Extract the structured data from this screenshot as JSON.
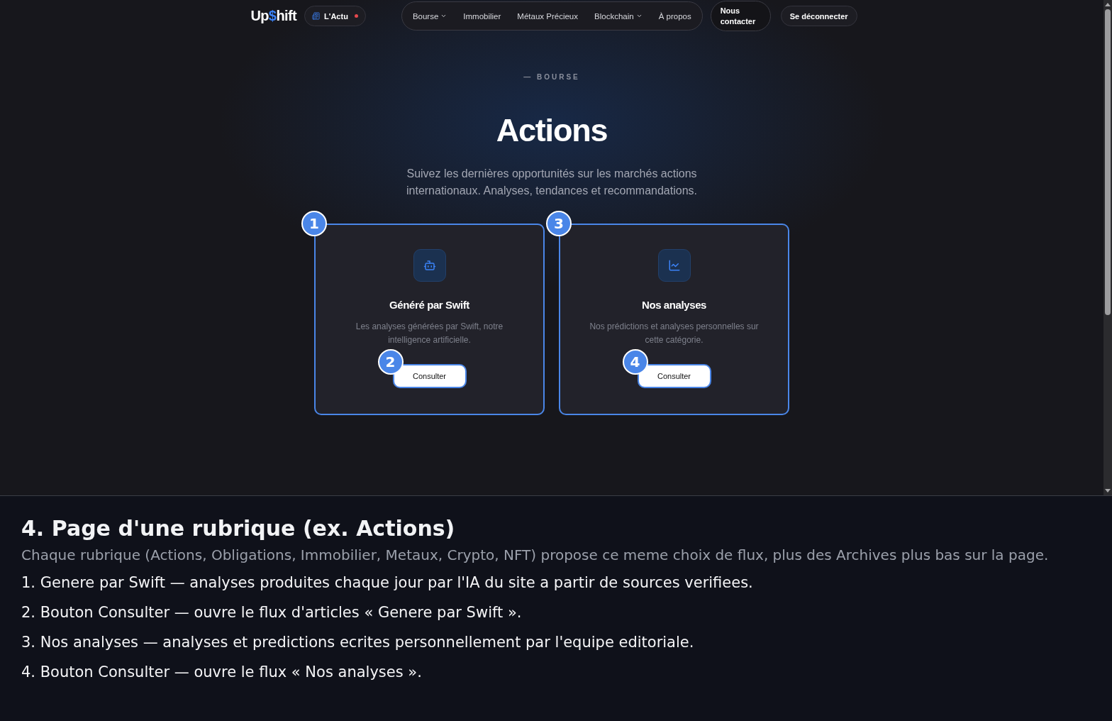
{
  "page": {
    "nav": {
      "logo": {
        "start": "Up",
        "accent": "$",
        "end": "hift"
      },
      "news_button": {
        "label": "L'Actu",
        "unread_dot": true
      },
      "menu": [
        {
          "label": "Bourse",
          "dropdown": true
        },
        {
          "label": "Immobilier",
          "dropdown": false
        },
        {
          "label": "Métaux Précieux",
          "dropdown": false
        },
        {
          "label": "Blockchain",
          "dropdown": true
        },
        {
          "label": "À propos",
          "dropdown": false
        }
      ],
      "contact_button": "Nous contacter",
      "logout_button": "Se déconnecter"
    },
    "hero": {
      "eyebrow": "— BOURSE",
      "title": "Actions",
      "subtitle": "Suivez les dernières opportunités sur les marchés actions internationaux. Analyses, tendances et recommandations."
    },
    "cards": [
      {
        "kind": "generated",
        "marker": "1",
        "title": "Généré par Swift",
        "description": "Les analyses générées par Swift, notre intelligence artificielle.",
        "button": {
          "label": "Consulter",
          "marker": "2"
        }
      },
      {
        "kind": "editorial",
        "marker": "3",
        "title": "Nos analyses",
        "description": "Nos prédictions et analyses personnelles sur cette catégorie.",
        "button": {
          "label": "Consulter",
          "marker": "4"
        }
      }
    ]
  },
  "explanation": {
    "heading": "4. Page d'une rubrique (ex. Actions)",
    "intro": "Chaque rubrique (Actions, Obligations, Immobilier, Metaux, Crypto, NFT) propose ce meme choix de flux, plus des Archives plus bas sur la page.",
    "items": [
      "1. Genere par Swift — analyses produites chaque jour par l'IA du site a partir de sources verifiees.",
      "2. Bouton Consulter — ouvre le flux d'articles « Genere par Swift ».",
      "3. Nos analyses — analyses et predictions ecrites personnellement par l'equipe editoriale.",
      "4. Bouton Consulter — ouvre le flux « Nos analyses »."
    ]
  }
}
